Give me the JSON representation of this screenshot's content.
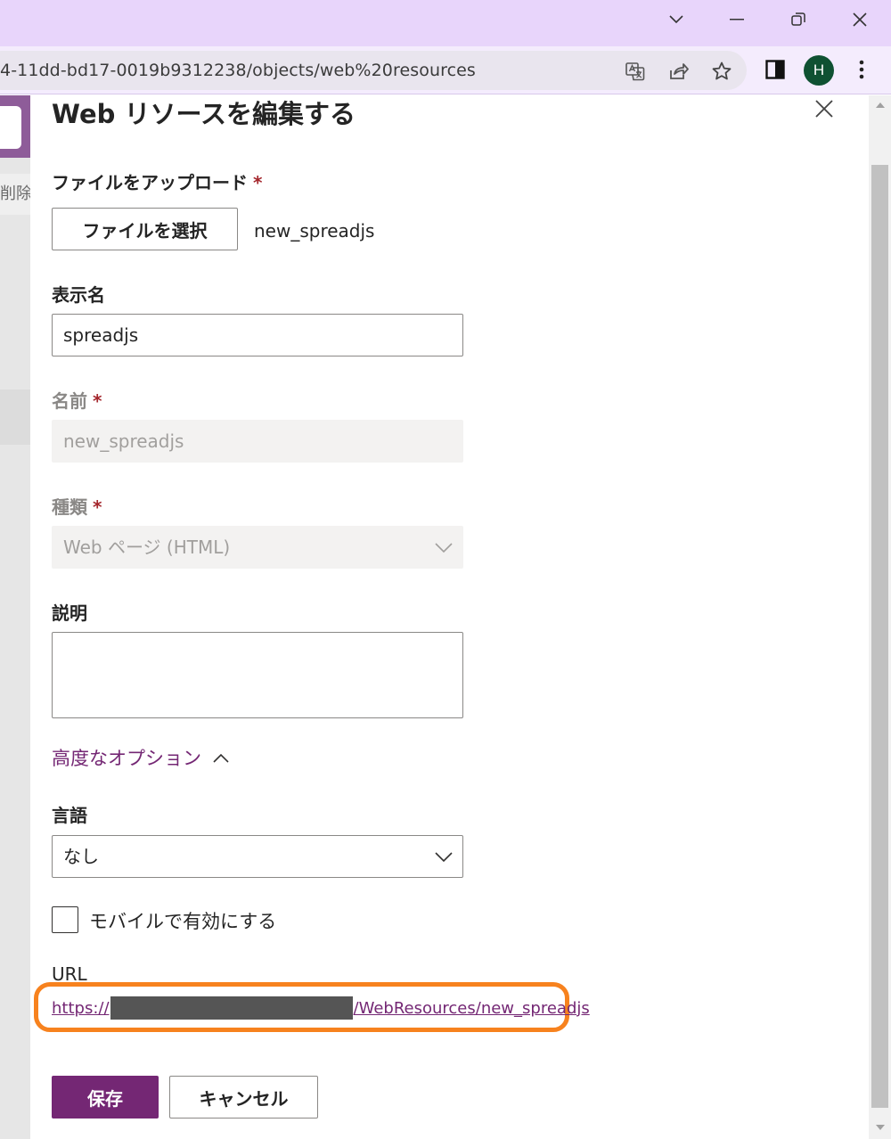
{
  "browser": {
    "url": "4-11dd-bd17-0019b9312238/objects/web%20resources",
    "profile_initial": "H",
    "profile_color": "#0f5132"
  },
  "background_page": {
    "command_label": "削除"
  },
  "panel": {
    "title": "Web リソースを編集する",
    "upload": {
      "label": "ファイルをアップロード",
      "required_mark": "*",
      "choose_button_label": "ファイルを選択",
      "file_name": "new_spreadjs"
    },
    "display_name": {
      "label": "表示名",
      "value": "spreadjs"
    },
    "name": {
      "label": "名前",
      "required_mark": "*",
      "value": "new_spreadjs"
    },
    "type": {
      "label": "種類",
      "required_mark": "*",
      "selected": "Web ページ (HTML)"
    },
    "description": {
      "label": "説明",
      "value": ""
    },
    "advanced_options_label": "高度なオプション",
    "language": {
      "label": "言語",
      "selected": "なし"
    },
    "mobile": {
      "label": "モバイルで有効にする",
      "checked": false
    },
    "url": {
      "label": "URL",
      "prefix": "https://",
      "suffix": "/WebResources/new_spreadjs"
    },
    "save_button_label": "保存",
    "cancel_button_label": "キャンセル"
  },
  "colors": {
    "brand": "#742774",
    "highlight": "#f7821e",
    "required": "#a4262c"
  }
}
